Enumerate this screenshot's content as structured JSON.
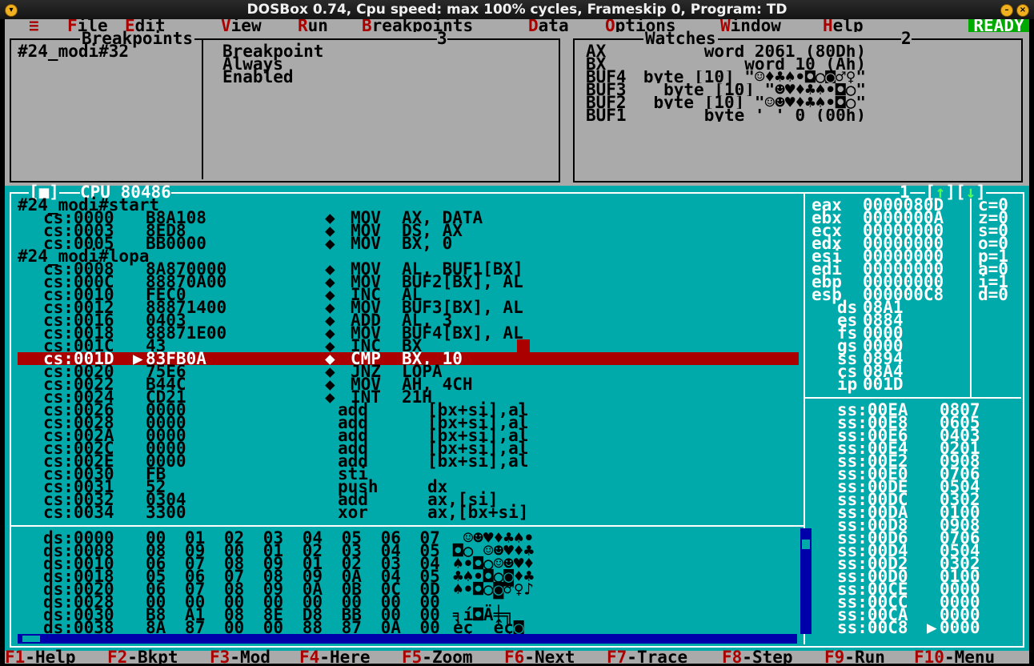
{
  "window": {
    "title": "DOSBox 0.74, Cpu speed: max 100% cycles, Frameskip  0, Program:       TD"
  },
  "menu": {
    "system_icon": "≡",
    "items": [
      {
        "label": "File",
        "hot": "F",
        "rest": "ile"
      },
      {
        "label": "Edit",
        "hot": "E",
        "rest": "dit"
      },
      {
        "label": "View",
        "hot": "V",
        "rest": "iew"
      },
      {
        "label": "Run",
        "hot": "R",
        "rest": "un"
      },
      {
        "label": "Breakpoints",
        "hot": "B",
        "rest": "reakpoints"
      },
      {
        "label": "Data",
        "hot": "D",
        "rest": "ata"
      },
      {
        "label": "Options",
        "hot": "O",
        "rest": "ptions"
      },
      {
        "label": "Window",
        "hot": "W",
        "rest": "indow"
      },
      {
        "label": "Help",
        "hot": "H",
        "rest": "elp"
      }
    ],
    "status": "READY"
  },
  "breakpoints": {
    "title": "Breakpoints",
    "number": "3",
    "entry": "#24_modi#32",
    "details": [
      "Breakpoint",
      "Always",
      "Enabled"
    ]
  },
  "watches": {
    "title": "Watches",
    "number": "2",
    "rows": [
      {
        "name": "AX",
        "value": "word 2061 (80Dh)"
      },
      {
        "name": "BX",
        "value": "word 10 (Ah)"
      },
      {
        "name": "BUF4",
        "value": "byte [10] \"☺♦♣♠•◘○◙♂♀\""
      },
      {
        "name": "BUF3",
        "value": "byte [10] \"☻♥♦♣♠•◘○\""
      },
      {
        "name": "BUF2",
        "value": "byte [10] \"☺☻♥♦♣♠•◘○\""
      },
      {
        "name": "BUF1",
        "value": "byte ' ' 0 (00h)"
      }
    ]
  },
  "cpu": {
    "title": "CPU 80486",
    "number": "1",
    "code": [
      {
        "label": "#24_modi#start"
      },
      {
        "addr": "cs:0000",
        "bytes": "B8A108",
        "bp": "◆",
        "mnem": "MOV",
        "ops": "AX, DATA"
      },
      {
        "addr": "cs:0003",
        "bytes": "8ED8",
        "bp": "◆",
        "mnem": "MOV",
        "ops": "DS, AX"
      },
      {
        "addr": "cs:0005",
        "bytes": "BB0000",
        "bp": "◆",
        "mnem": "MOV",
        "ops": "BX, 0"
      },
      {
        "label": "#24_modi#lopa"
      },
      {
        "addr": "cs:0008",
        "bytes": "8A870000",
        "bp": "◆",
        "mnem": "MOV",
        "ops": "AL, BUF1[BX]"
      },
      {
        "addr": "cs:000C",
        "bytes": "88870A00",
        "bp": "◆",
        "mnem": "MOV",
        "ops": "BUF2[BX], AL"
      },
      {
        "addr": "cs:0010",
        "bytes": "FEC0",
        "bp": "◆",
        "mnem": "INC",
        "ops": "AL"
      },
      {
        "addr": "cs:0012",
        "bytes": "88871400",
        "bp": "◆",
        "mnem": "MOV",
        "ops": "BUF3[BX], AL"
      },
      {
        "addr": "cs:0016",
        "bytes": "0403",
        "bp": "◆",
        "mnem": "ADD",
        "ops": "AL, 3"
      },
      {
        "addr": "cs:0018",
        "bytes": "88871E00",
        "bp": "◆",
        "mnem": "MOV",
        "ops": "BUF4[BX], AL"
      },
      {
        "addr": "cs:001C",
        "bytes": "43",
        "bp": "◆",
        "mnem": "INC",
        "ops": "BX"
      },
      {
        "addr": "cs:001D",
        "bytes": "83FB0A",
        "bp": "◆",
        "mnem": "CMP",
        "ops": "BX, 10",
        "current": true
      },
      {
        "addr": "cs:0020",
        "bytes": "75E6",
        "bp": "◆",
        "mnem": "JNZ",
        "ops": "LOPA"
      },
      {
        "addr": "cs:0022",
        "bytes": "B44C",
        "bp": "◆",
        "mnem": "MOV",
        "ops": "AH, 4CH"
      },
      {
        "addr": "cs:0024",
        "bytes": "CD21",
        "bp": "◆",
        "mnem": "INT",
        "ops": "21H"
      },
      {
        "addr": "cs:0026",
        "bytes": "0000",
        "bp": "",
        "mnem": "add",
        "ops": "[bx+si],al"
      },
      {
        "addr": "cs:0028",
        "bytes": "0000",
        "bp": "",
        "mnem": "add",
        "ops": "[bx+si],al"
      },
      {
        "addr": "cs:002A",
        "bytes": "0000",
        "bp": "",
        "mnem": "add",
        "ops": "[bx+si],al"
      },
      {
        "addr": "cs:002C",
        "bytes": "0000",
        "bp": "",
        "mnem": "add",
        "ops": "[bx+si],al"
      },
      {
        "addr": "cs:002E",
        "bytes": "0000",
        "bp": "",
        "mnem": "add",
        "ops": "[bx+si],al"
      },
      {
        "addr": "cs:0030",
        "bytes": "FB",
        "bp": "",
        "mnem": "sti",
        "ops": ""
      },
      {
        "addr": "cs:0031",
        "bytes": "52",
        "bp": "",
        "mnem": "push",
        "ops": "dx"
      },
      {
        "addr": "cs:0032",
        "bytes": "0304",
        "bp": "",
        "mnem": "add",
        "ops": "ax,[si]"
      },
      {
        "addr": "cs:0034",
        "bytes": "3300",
        "bp": "",
        "mnem": "xor",
        "ops": "ax,[bx+si]"
      }
    ],
    "registers": [
      {
        "name": "eax",
        "value": "0000080D"
      },
      {
        "name": "ebx",
        "value": "0000000A"
      },
      {
        "name": "ecx",
        "value": "00000000"
      },
      {
        "name": "edx",
        "value": "00000000"
      },
      {
        "name": "esi",
        "value": "00000000"
      },
      {
        "name": "edi",
        "value": "00000000"
      },
      {
        "name": "ebp",
        "value": "00000000"
      },
      {
        "name": "esp",
        "value": "000000C8"
      },
      {
        "name": "ds",
        "value": "08A1"
      },
      {
        "name": "es",
        "value": "0884"
      },
      {
        "name": "fs",
        "value": "0000"
      },
      {
        "name": "gs",
        "value": "0000"
      },
      {
        "name": "ss",
        "value": "0894"
      },
      {
        "name": "cs",
        "value": "08A4"
      },
      {
        "name": "ip",
        "value": "001D"
      }
    ],
    "flags": [
      "c=0",
      "z=0",
      "s=0",
      "o=0",
      "p=1",
      "a=0",
      "i=1",
      "d=0"
    ],
    "dump": [
      {
        "addr": "ds:0000",
        "bytes": "00 01 02 03 04 05 06 07",
        "ascii": " ☺☻♥♦♣♠•"
      },
      {
        "addr": "ds:0008",
        "bytes": "08 09 00 01 02 03 04 05",
        "ascii": "◘○ ☺☻♥♦♣"
      },
      {
        "addr": "ds:0010",
        "bytes": "06 07 08 09 01 02 03 04",
        "ascii": "♠•◘○☺☻♥♦"
      },
      {
        "addr": "ds:0018",
        "bytes": "05 06 07 08 09 0A 04 05",
        "ascii": "♣♠•◘○◙♦♣"
      },
      {
        "addr": "ds:0020",
        "bytes": "06 07 08 09 0A 0B 0C 0D",
        "ascii": "♠•◘○◙♂♀♪"
      },
      {
        "addr": "ds:0028",
        "bytes": "00 00 00 00 00 00 00 00",
        "ascii": "        "
      },
      {
        "addr": "ds:0030",
        "bytes": "B8 A1 08 8E D8 BB 00 00",
        "ascii": "╕í◘Ä╪╗  "
      },
      {
        "addr": "ds:0038",
        "bytes": "8A 87 00 00 88 87 0A 00",
        "ascii": "èç  êç◙ "
      }
    ],
    "stack": [
      {
        "addr": "ss:00EA",
        "value": "0807"
      },
      {
        "addr": "ss:00E8",
        "value": "0605"
      },
      {
        "addr": "ss:00E6",
        "value": "0403"
      },
      {
        "addr": "ss:00E4",
        "value": "0201"
      },
      {
        "addr": "ss:00E2",
        "value": "0908"
      },
      {
        "addr": "ss:00E0",
        "value": "0706"
      },
      {
        "addr": "ss:00DE",
        "value": "0504"
      },
      {
        "addr": "ss:00DC",
        "value": "0302"
      },
      {
        "addr": "ss:00DA",
        "value": "0100"
      },
      {
        "addr": "ss:00D8",
        "value": "0908"
      },
      {
        "addr": "ss:00D6",
        "value": "0706"
      },
      {
        "addr": "ss:00D4",
        "value": "0504"
      },
      {
        "addr": "ss:00D2",
        "value": "0302"
      },
      {
        "addr": "ss:00D0",
        "value": "0100"
      },
      {
        "addr": "ss:00CE",
        "value": "0000"
      },
      {
        "addr": "ss:00CC",
        "value": "0000"
      },
      {
        "addr": "ss:00CA",
        "value": "0000"
      },
      {
        "addr": "ss:00C8",
        "value": "0000",
        "current": true
      }
    ]
  },
  "keys": [
    {
      "key": "F1",
      "label": "Help"
    },
    {
      "key": "F2",
      "label": "Bkpt"
    },
    {
      "key": "F3",
      "label": "Mod"
    },
    {
      "key": "F4",
      "label": "Here"
    },
    {
      "key": "F5",
      "label": "Zoom"
    },
    {
      "key": "F6",
      "label": "Next"
    },
    {
      "key": "F7",
      "label": "Trace"
    },
    {
      "key": "F8",
      "label": "Step"
    },
    {
      "key": "F9",
      "label": "Run"
    },
    {
      "key": "F10",
      "label": "Menu"
    }
  ]
}
